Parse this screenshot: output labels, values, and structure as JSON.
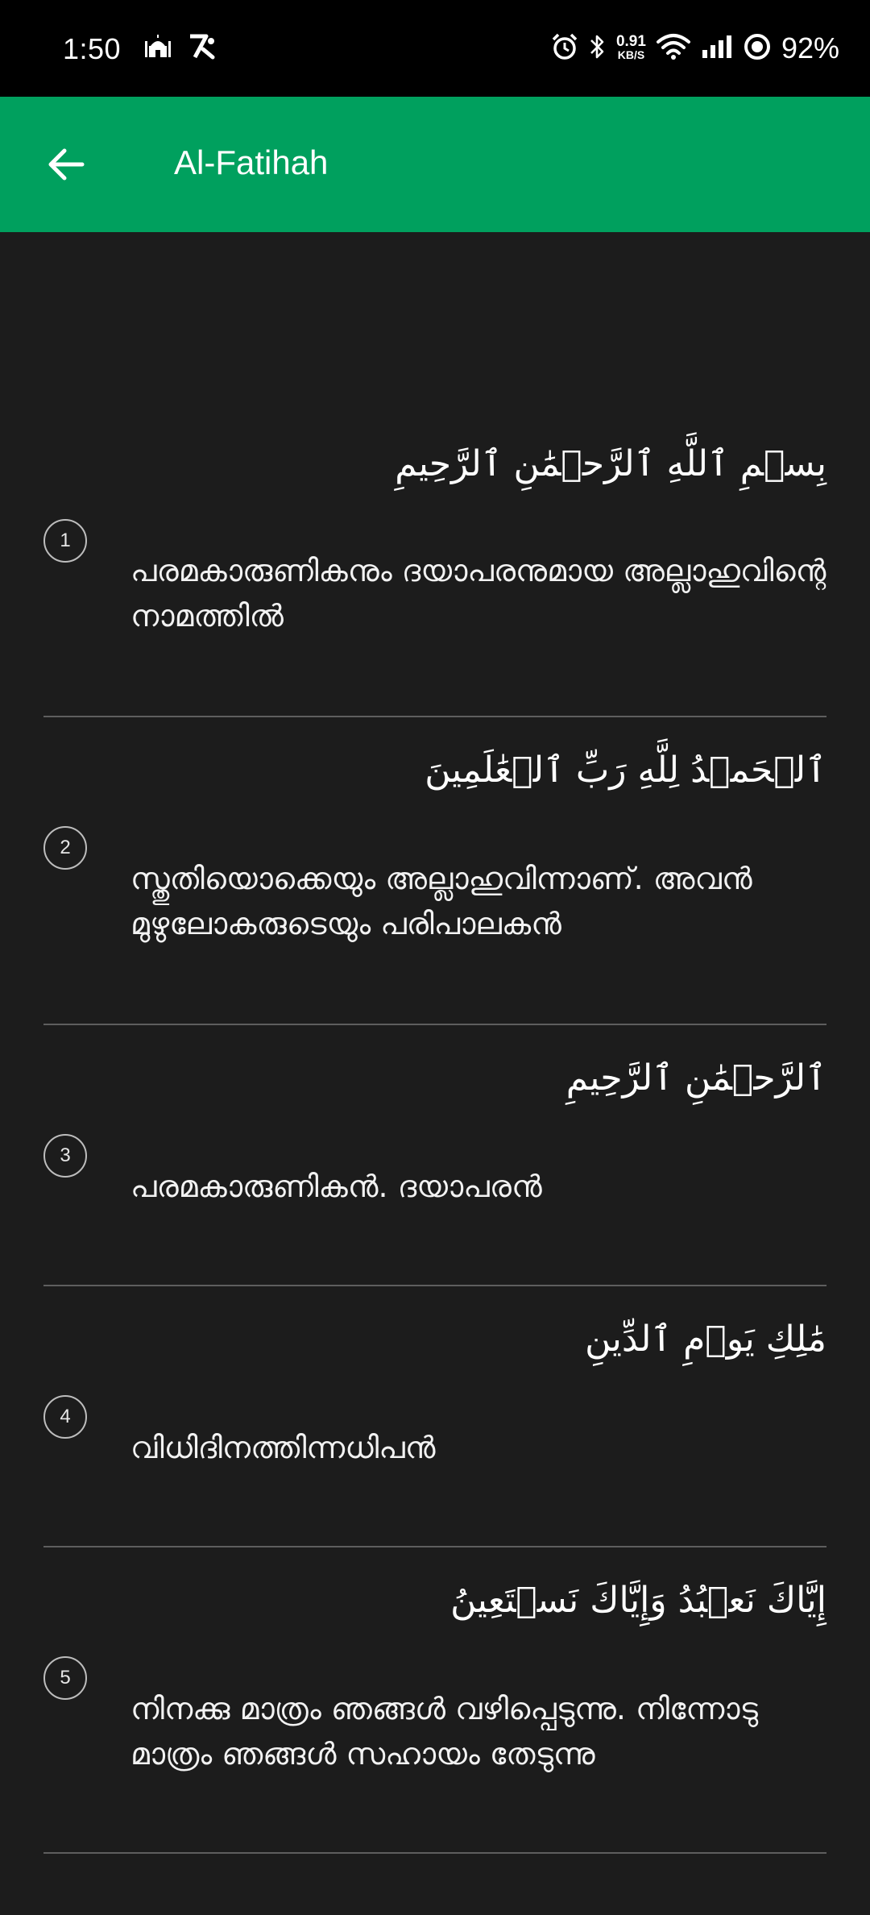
{
  "status_bar": {
    "time": "1:50",
    "left_icons": [
      "mosque-icon",
      "app-notification-icon"
    ],
    "network_speed_value": "0.91",
    "network_speed_unit": "KB/S",
    "battery": "92%"
  },
  "app_bar": {
    "title": "Al-Fatihah",
    "color": "#00a05e"
  },
  "verses": [
    {
      "number": "1",
      "arabic": "بِسۡمِ ٱللَّهِ ٱلرَّحۡمَٰنِ ٱلرَّحِيمِ",
      "translation": "പരമകാരുണികനും ദയാപരനുമായ അല്ലാഹുവിന്റെ നാമത്തില്‍"
    },
    {
      "number": "2",
      "arabic": "ٱلۡحَمۡدُ لِلَّهِ رَبِّ ٱلۡعَٰلَمِينَ",
      "translation": "സ്തുതിയൊക്കെയും അല്ലാഹുവിന്നാണ്. അവന്‍ മുഴുലോകരുടെയും പരിപാലകന്‍"
    },
    {
      "number": "3",
      "arabic": "ٱلرَّحۡمَٰنِ ٱلرَّحِيمِ",
      "translation": "പരമകാരുണികന്‍. ദയാപരന്‍"
    },
    {
      "number": "4",
      "arabic": "مَٰلِكِ يَوۡمِ ٱلدِّينِ",
      "translation": "വിധിദിനത്തിന്നധിപന്‍"
    },
    {
      "number": "5",
      "arabic": "إِيَّاكَ نَعۡبُدُ وَإِيَّاكَ نَسۡتَعِينُ",
      "translation": "നിനക്കു മാത്രം ഞങ്ങള്‍ വഴിപ്പെടുന്നു. നിന്നോടു മാത്രം ഞങ്ങള്‍ സഹായം തേടുന്നു"
    }
  ]
}
